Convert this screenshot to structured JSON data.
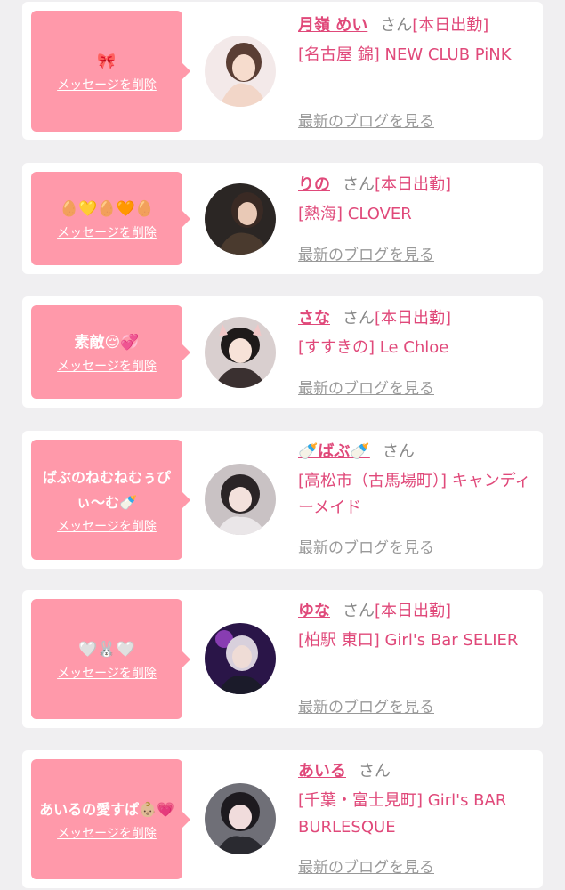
{
  "colors": {
    "bubble": "#ff99aa",
    "accent": "#e0497a",
    "bg": "#f0eff1"
  },
  "delete_label": "メッセージを削除",
  "blog_label": "最新のブログを見る",
  "items": [
    {
      "message": "🎀",
      "name": "月嶺 めい",
      "san": "さん",
      "status": "[本日出勤]",
      "shop": "[名古屋 錦] NEW CLUB PiNK"
    },
    {
      "message": "🥚💛🥚🧡🥚",
      "name": "りの",
      "san": "さん",
      "status": "[本日出勤]",
      "shop": "[熱海] CLOVER"
    },
    {
      "message": "素敵😌💞",
      "name": "さな",
      "san": "さん",
      "status": "[本日出勤]",
      "shop": "[すすきの] Le Chloe"
    },
    {
      "message": "ばぶのねむねむぅぴぃ〜む🍼",
      "name": "🍼ばぶ🍼",
      "san": "さん",
      "status": "",
      "shop": "[高松市（古馬場町）] キャンディーメイド"
    },
    {
      "message": "🤍🐰🤍",
      "name": "ゆな",
      "san": "さん",
      "status": "[本日出勤]",
      "shop": "[柏駅 東口] Girl's Bar SELIER"
    },
    {
      "message": "あいるの愛すぱ👶🏼💗",
      "name": "あいる",
      "san": "さん",
      "status": "",
      "shop": "[千葉・富士見町] Girl's BAR BURLESQUE"
    }
  ]
}
